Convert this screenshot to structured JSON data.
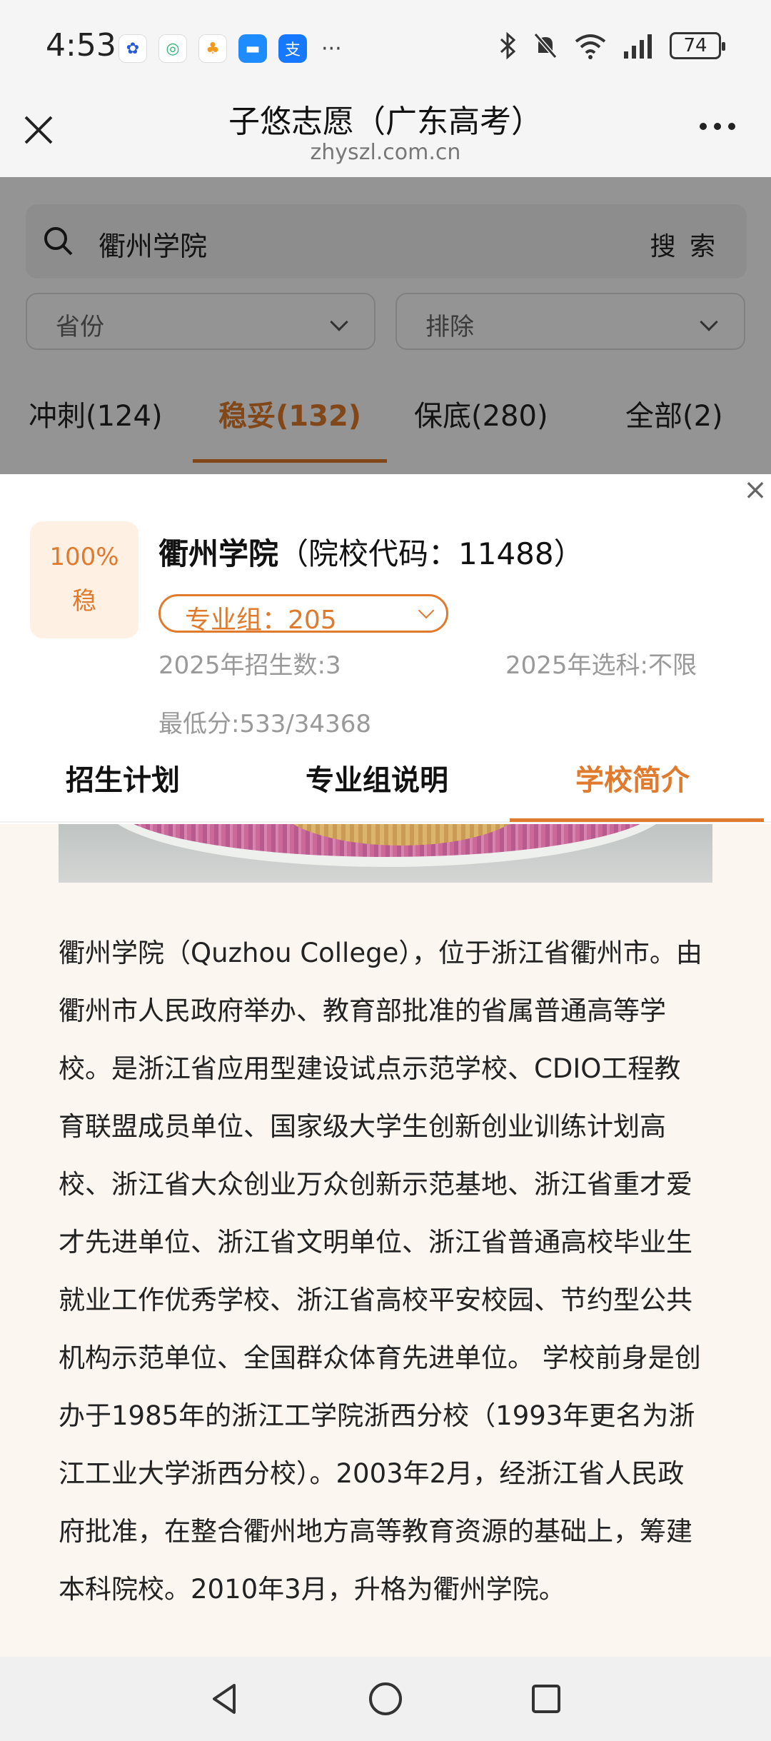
{
  "status_bar": {
    "time": "4:53",
    "battery": "74",
    "apps": [
      "baidu-icon",
      "360-icon",
      "taobao-icon",
      "messenger-icon",
      "alipay-icon"
    ]
  },
  "title_bar": {
    "title": "子悠志愿（广东高考）",
    "url": "zhyszl.com.cn"
  },
  "search": {
    "value": "衢州学院",
    "button": "搜 索"
  },
  "filters": {
    "province": "省份",
    "exclude": "排除"
  },
  "risk_tabs": [
    {
      "label": "冲刺(124)"
    },
    {
      "label": "稳妥(132)"
    },
    {
      "label": "保底(280)"
    },
    {
      "label": "全部(2)"
    }
  ],
  "detail": {
    "probability": "100%",
    "level": "稳",
    "school_name": "衢州学院",
    "school_code": "（院校代码：11488）",
    "group": "专业组：205",
    "enroll_count": "2025年招生数:3",
    "subject_req": "2025年选科:不限",
    "min_score": "最低分:533/34368"
  },
  "detail_tabs": [
    {
      "label": "招生计划"
    },
    {
      "label": "专业组说明"
    },
    {
      "label": "学校简介"
    }
  ],
  "intro_lines": [
    "衢州学院（Quzhou College），位于浙江省衢州市。由",
    "衢州市人民政府举办、教育部批准的省属普通高等学",
    "校。是浙江省应用型建设试点示范学校、CDIO工程教",
    "育联盟成员单位、国家级大学生创新创业训练计划高",
    "校、浙江省大众创业万众创新示范基地、浙江省重才爱",
    "才先进单位、浙江省文明单位、浙江省普通高校毕业生",
    "就业工作优秀学校、浙江省高校平安校园、节约型公共",
    "机构示范单位、全国群众体育先进单位。 学校前身是创",
    "办于1985年的浙江工学院浙西分校（1993年更名为浙",
    "江工业大学浙西分校）。2003年2月，经浙江省人民政",
    "府批准，在整合衢州地方高等教育资源的基础上，筹建",
    "本科院校。2010年3月，升格为衢州学院。"
  ],
  "colors": {
    "accent": "#e07a2c",
    "badge_bg": "#fff0e4"
  }
}
